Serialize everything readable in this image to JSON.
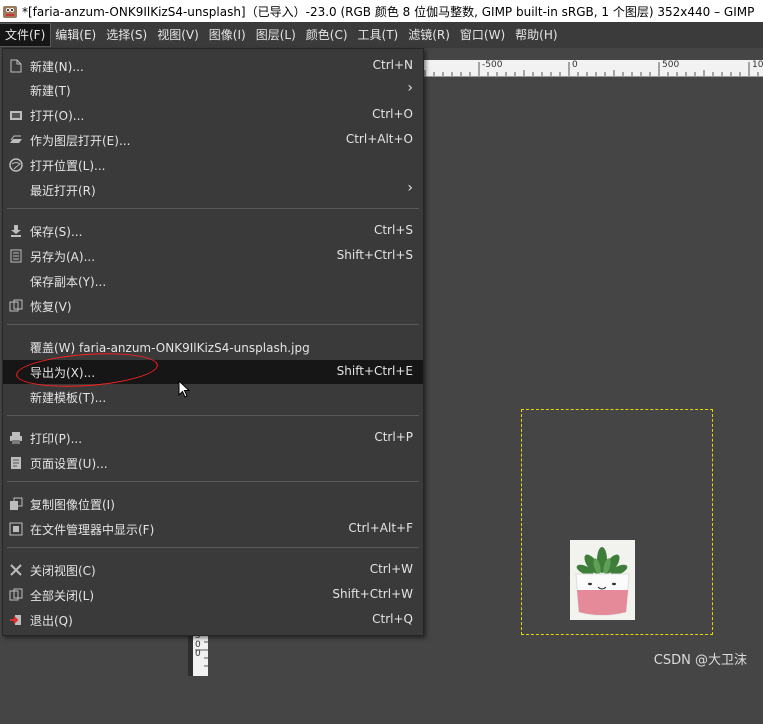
{
  "window": {
    "title": "*[faria-anzum-ONK9IlKizS4-unsplash]（已导入）-23.0 (RGB 颜色 8 位伽马整数, GIMP built-in sRGB, 1 个图层) 352x440 – GIMP"
  },
  "menubar": [
    {
      "label": "文件(F)"
    },
    {
      "label": "编辑(E)"
    },
    {
      "label": "选择(S)"
    },
    {
      "label": "视图(V)"
    },
    {
      "label": "图像(I)"
    },
    {
      "label": "图层(L)"
    },
    {
      "label": "颜色(C)"
    },
    {
      "label": "工具(T)"
    },
    {
      "label": "滤镜(R)"
    },
    {
      "label": "窗口(W)"
    },
    {
      "label": "帮助(H)"
    }
  ],
  "file_menu": {
    "items": [
      {
        "label": "新建(N)...",
        "shortcut": "Ctrl+N",
        "icon": "new-icon"
      },
      {
        "label": "新建(T)",
        "shortcut": "",
        "icon": "",
        "submenu": true
      },
      {
        "label": "打开(O)...",
        "shortcut": "Ctrl+O",
        "icon": "open-icon"
      },
      {
        "label": "作为图层打开(E)...",
        "shortcut": "Ctrl+Alt+O",
        "icon": "open-as-layers-icon"
      },
      {
        "label": "打开位置(L)...",
        "shortcut": "",
        "icon": "open-location-icon"
      },
      {
        "label": "最近打开(R)",
        "shortcut": "",
        "icon": "",
        "submenu": true
      },
      {
        "label": "保存(S)...",
        "shortcut": "Ctrl+S",
        "icon": "save-icon"
      },
      {
        "label": "另存为(A)...",
        "shortcut": "Shift+Ctrl+S",
        "icon": "save-as-icon"
      },
      {
        "label": "保存副本(Y)...",
        "shortcut": "",
        "icon": ""
      },
      {
        "label": "恢复(V)",
        "shortcut": "",
        "icon": "revert-icon"
      },
      {
        "label": "覆盖(W) faria-anzum-ONK9IlKizS4-unsplash.jpg",
        "shortcut": "",
        "icon": ""
      },
      {
        "label": "导出为(X)...",
        "shortcut": "Shift+Ctrl+E",
        "icon": ""
      },
      {
        "label": "新建模板(T)...",
        "shortcut": "",
        "icon": ""
      },
      {
        "label": "打印(P)...",
        "shortcut": "Ctrl+P",
        "icon": "print-icon"
      },
      {
        "label": "页面设置(U)...",
        "shortcut": "",
        "icon": "page-setup-icon"
      },
      {
        "label": "复制图像位置(I)",
        "shortcut": "",
        "icon": "copy-location-icon"
      },
      {
        "label": "在文件管理器中显示(F)",
        "shortcut": "Ctrl+Alt+F",
        "icon": "file-manager-icon"
      },
      {
        "label": "关闭视图(C)",
        "shortcut": "Ctrl+W",
        "icon": "close-icon"
      },
      {
        "label": "全部关闭(L)",
        "shortcut": "Shift+Ctrl+W",
        "icon": "close-all-icon"
      },
      {
        "label": "退出(Q)",
        "shortcut": "Ctrl+Q",
        "icon": "quit-icon"
      }
    ]
  },
  "ruler": {
    "top_ticks": [
      "-500",
      "0",
      "500",
      "10"
    ],
    "left_ticks": "500"
  },
  "watermark": "CSDN @大卫沫"
}
